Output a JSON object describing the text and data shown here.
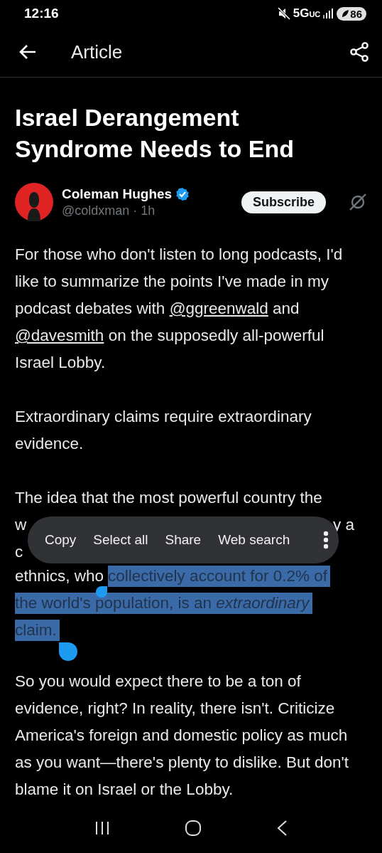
{
  "status_bar": {
    "time": "12:16",
    "network": "5G",
    "network_sub": "UC",
    "battery": "86"
  },
  "app_bar": {
    "title": "Article"
  },
  "article": {
    "title": "Israel Derangement Syndrome Needs to End",
    "author": {
      "name": "Coleman Hughes",
      "verified": true,
      "handle": "@coldxman · 1h",
      "subscribe": "Subscribe"
    },
    "paragraphs": [
      {
        "kind": "text",
        "parts": [
          {
            "kind": "text",
            "text": "For those who don't listen to long podcasts, I'd like to summarize the points I've made in my podcast debates with "
          },
          {
            "kind": "link",
            "text": "@ggreenwald"
          },
          {
            "kind": "text",
            "text": " and "
          },
          {
            "kind": "link",
            "text": "@davesmith"
          },
          {
            "kind": "text",
            "text": " on the supposedly all-powerful Israel Lobby."
          }
        ]
      },
      {
        "kind": "text",
        "parts": [
          {
            "kind": "text",
            "text": "Extraordinary claims require extraordinary evidence."
          }
        ]
      },
      {
        "kind": "selection",
        "lines": [
          {
            "kind": "plain",
            "text": "The idea that the most powerful country the"
          },
          {
            "kind": "covered",
            "left": "w",
            "right": "y a"
          },
          {
            "kind": "covered",
            "left": "c"
          },
          {
            "kind": "mixed",
            "before": "ethnics, who",
            "selected": "collectively account for 0.2% of"
          },
          {
            "kind": "selected",
            "text": "the world's population, is an *extraordinary*"
          },
          {
            "kind": "selected",
            "text": "claim."
          }
        ]
      },
      {
        "kind": "text",
        "parts": [
          {
            "kind": "text",
            "text": "So you would expect there to be a ton of evidence, right? In reality, there isn't. Criticize America's foreign and domestic policy as much as you want—there's plenty to dislike. But don't blame it on Israel or the Lobby."
          }
        ]
      }
    ]
  },
  "selection_menu": [
    "Copy",
    "Select all",
    "Share",
    "Web search"
  ]
}
